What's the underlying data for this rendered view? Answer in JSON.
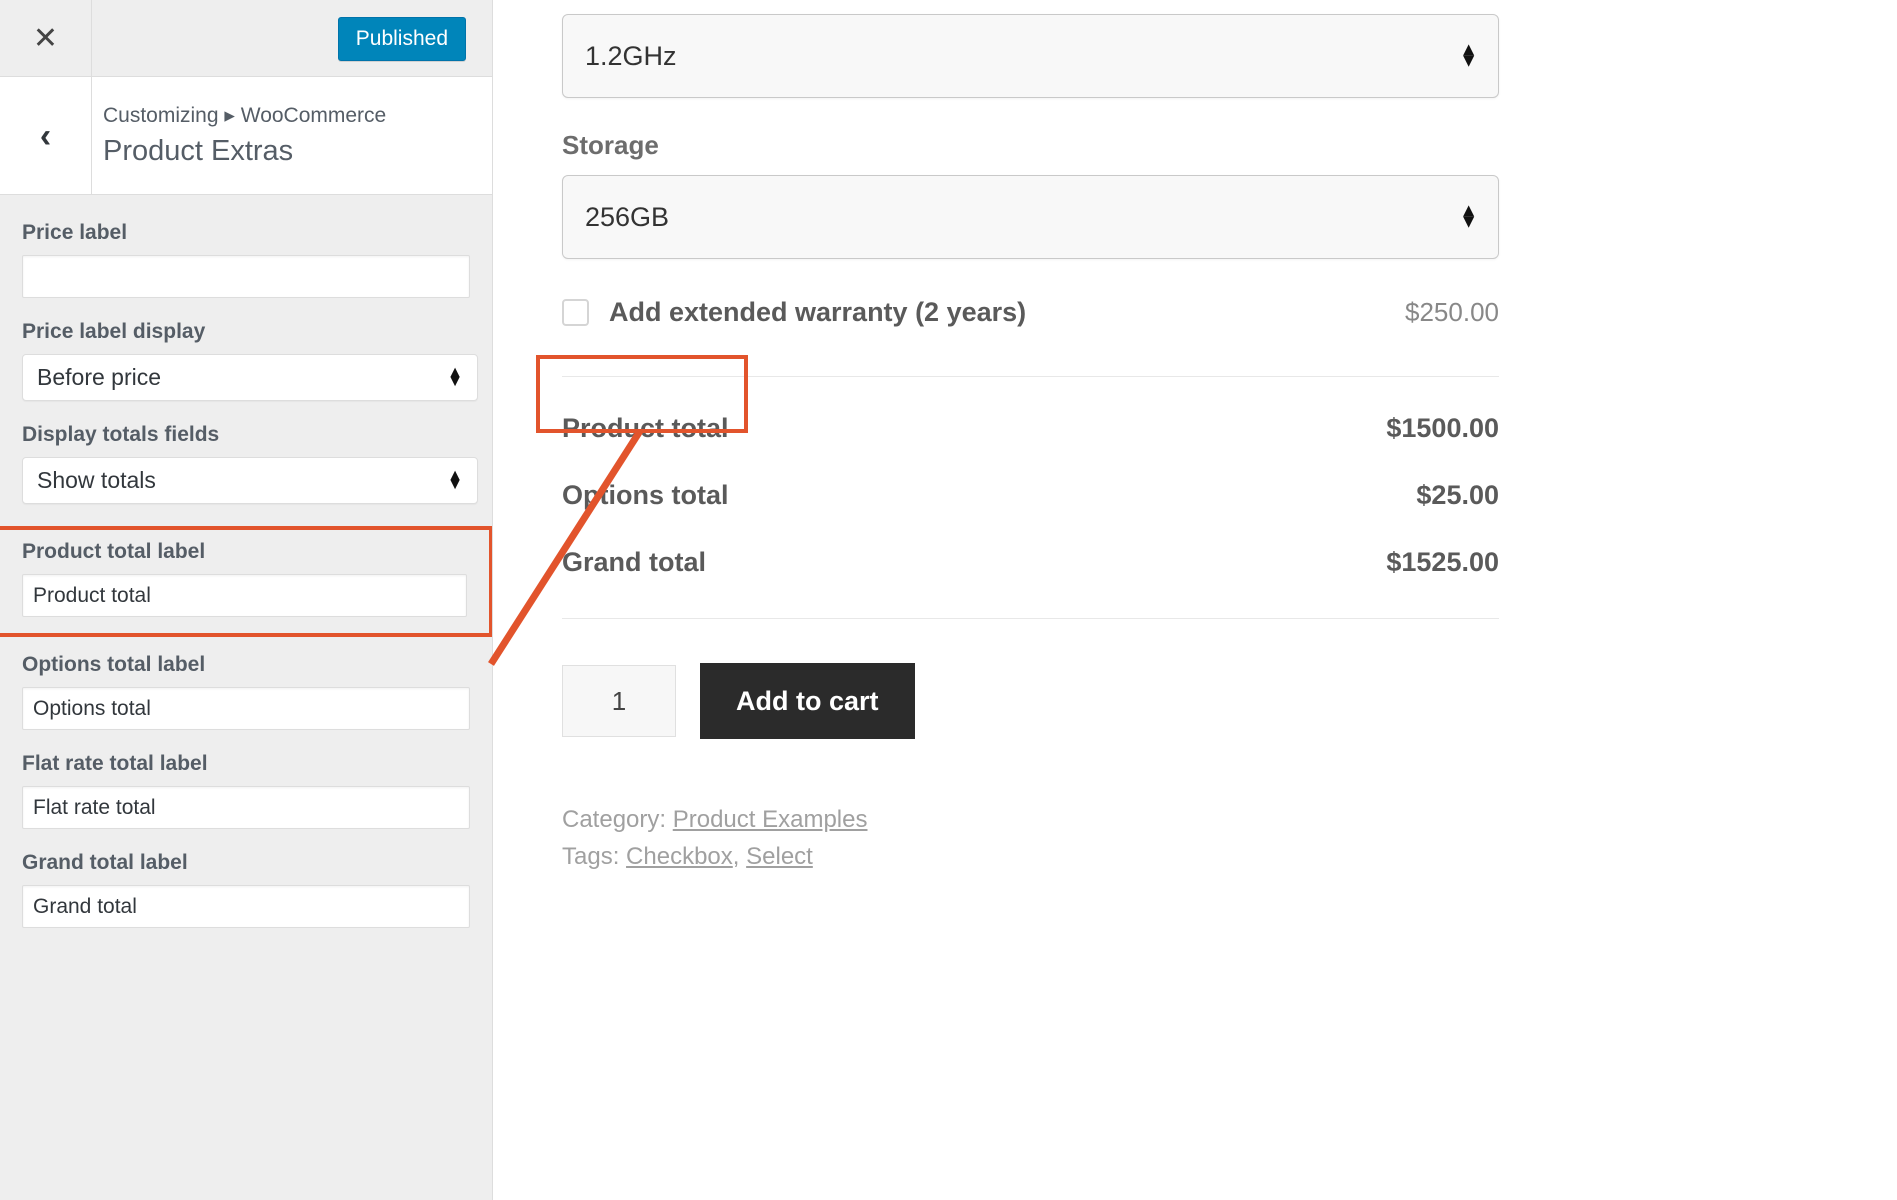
{
  "customizer": {
    "close_icon": "close-icon",
    "back_icon": "back-chevron-icon",
    "publish_button": "Published",
    "breadcrumb": "Customizing ▸ WooCommerce",
    "panel_title": "Product Extras",
    "fields": [
      {
        "label": "Price label",
        "type": "text",
        "value": ""
      },
      {
        "label": "Price label display",
        "type": "select",
        "value": "Before price"
      },
      {
        "label": "Display totals fields",
        "type": "select",
        "value": "Show totals"
      },
      {
        "label": "Product total label",
        "type": "text",
        "value": "Product total",
        "highlighted": true
      },
      {
        "label": "Options total label",
        "type": "text",
        "value": "Options total"
      },
      {
        "label": "Flat rate total label",
        "type": "text",
        "value": "Flat rate total"
      },
      {
        "label": "Grand total label",
        "type": "text",
        "value": "Grand total"
      }
    ]
  },
  "preview": {
    "speed_select": "1.2GHz",
    "storage_label": "Storage",
    "storage_select": "256GB",
    "warranty": {
      "label": "Add extended warranty (2 years)",
      "price": "$250.00",
      "checked": false
    },
    "totals": [
      {
        "label": "Product total",
        "value": "$1500.00",
        "highlighted": true
      },
      {
        "label": "Options total",
        "value": "$25.00"
      },
      {
        "label": "Grand total",
        "value": "$1525.00"
      }
    ],
    "quantity": "1",
    "add_to_cart": "Add to cart",
    "meta": {
      "category_prefix": "Category:",
      "category_link": "Product Examples",
      "tags_prefix": "Tags:",
      "tag_links": [
        "Checkbox",
        "Select"
      ],
      "tag_separator": ","
    }
  },
  "annotation": {
    "accent_color": "#e2542c"
  }
}
